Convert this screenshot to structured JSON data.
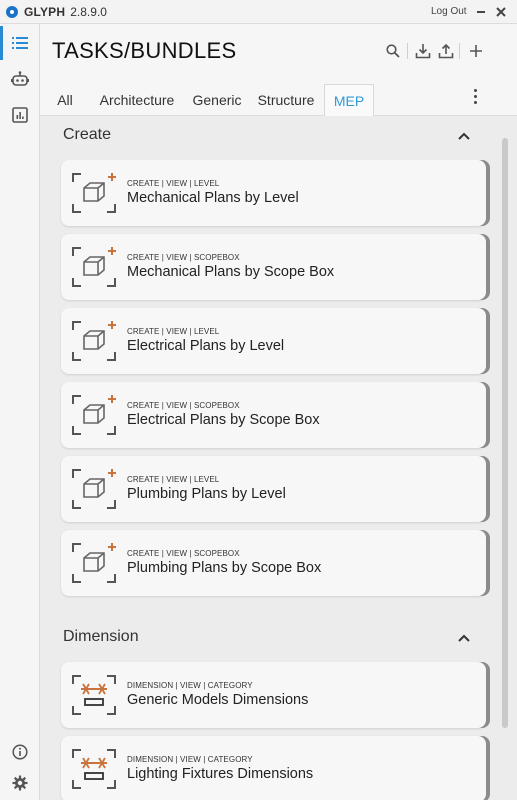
{
  "app": {
    "name": "GLYPH",
    "version": "2.8.9.0",
    "logout_label": "Log Out"
  },
  "header": {
    "title": "TASKS/BUNDLES"
  },
  "tabs": [
    {
      "label": "All"
    },
    {
      "label": "Architecture"
    },
    {
      "label": "Generic"
    },
    {
      "label": "Structure"
    },
    {
      "label": "MEP",
      "active": true
    }
  ],
  "sections": [
    {
      "title": "Create",
      "items": [
        {
          "tag": "CREATE | VIEW | LEVEL",
          "name": "Mechanical Plans by Level",
          "icon": "view-create-icon"
        },
        {
          "tag": "CREATE | VIEW | SCOPEBOX",
          "name": "Mechanical Plans by Scope Box",
          "icon": "view-create-icon"
        },
        {
          "tag": "CREATE | VIEW | LEVEL",
          "name": "Electrical Plans by Level",
          "icon": "view-create-icon"
        },
        {
          "tag": "CREATE | VIEW | SCOPEBOX",
          "name": "Electrical Plans by Scope Box",
          "icon": "view-create-icon"
        },
        {
          "tag": "CREATE | VIEW | LEVEL",
          "name": "Plumbing Plans by Level",
          "icon": "view-create-icon"
        },
        {
          "tag": "CREATE | VIEW | SCOPEBOX",
          "name": "Plumbing Plans by Scope Box",
          "icon": "view-create-icon"
        }
      ]
    },
    {
      "title": "Dimension",
      "items": [
        {
          "tag": "DIMENSION | VIEW | CATEGORY",
          "name": "Generic Models Dimensions",
          "icon": "dimension-icon"
        },
        {
          "tag": "DIMENSION | VIEW | CATEGORY",
          "name": "Lighting Fixtures Dimensions",
          "icon": "dimension-icon"
        }
      ]
    }
  ],
  "colors": {
    "accent": "#2f9ad8",
    "icon_orange": "#c8743c",
    "icon_gray": "#555555"
  }
}
